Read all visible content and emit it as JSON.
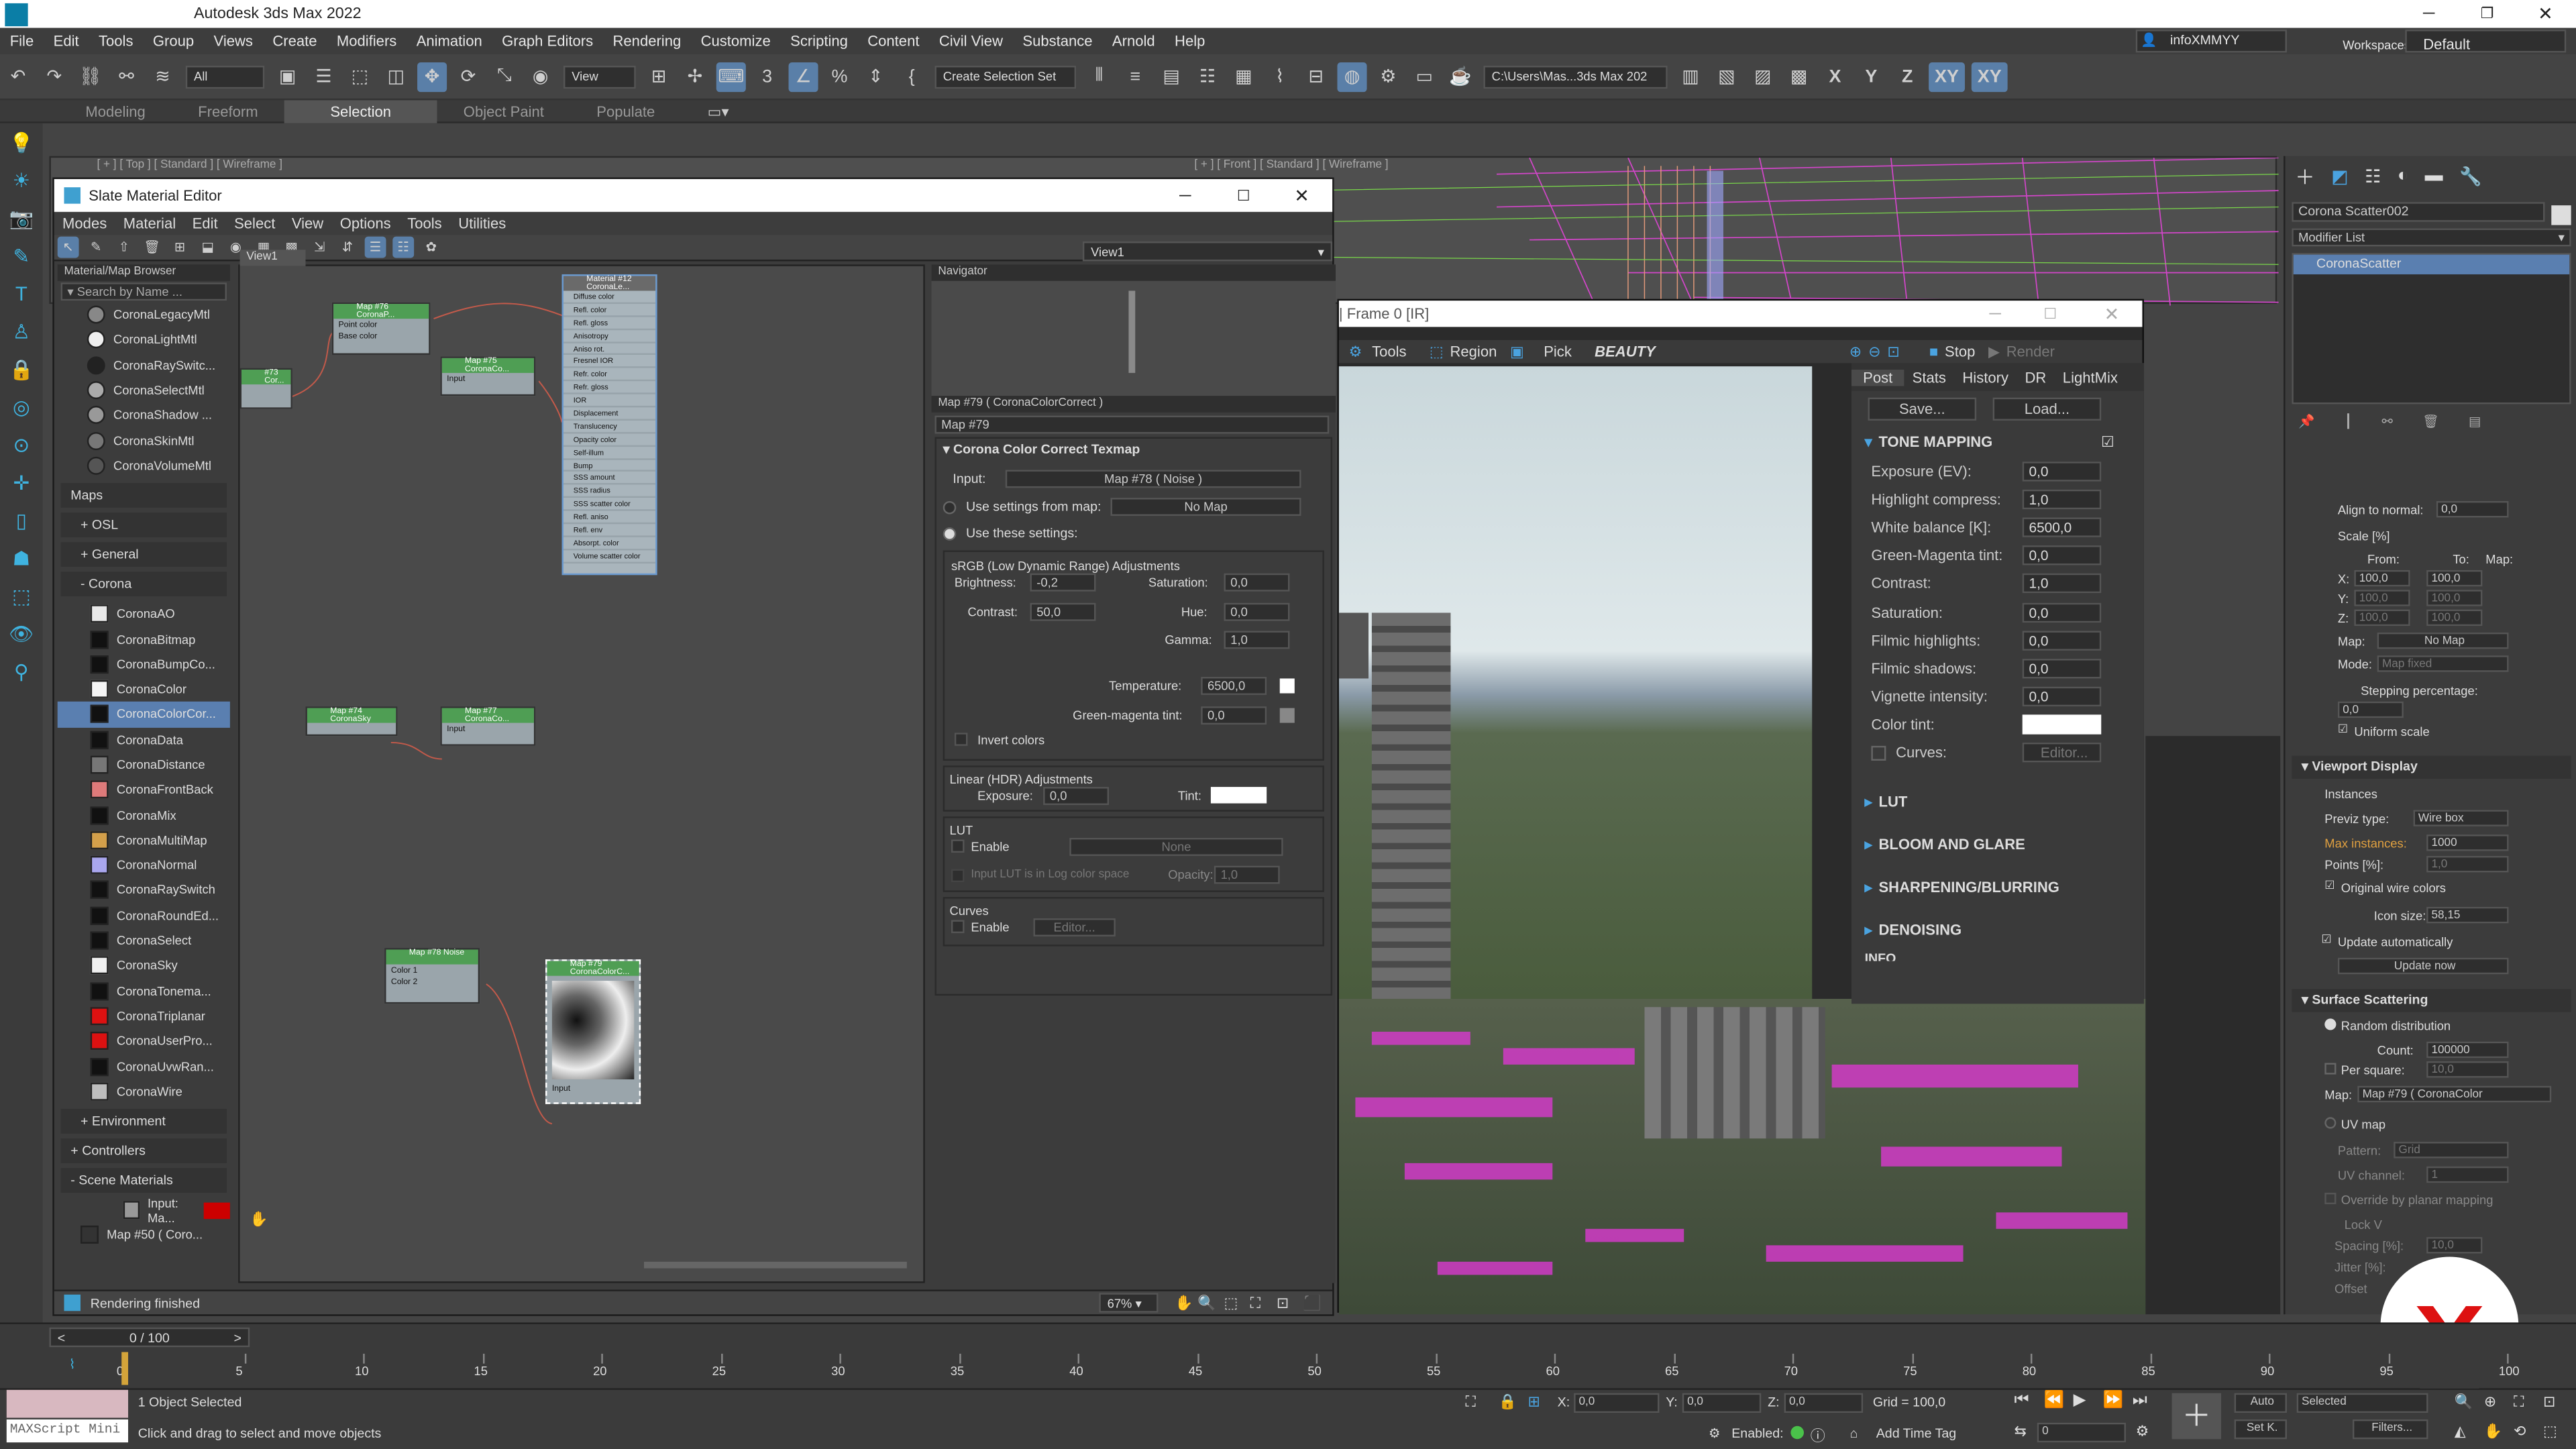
{
  "app": {
    "title": "Autodesk 3ds Max 2022"
  },
  "menu": [
    "File",
    "Edit",
    "Tools",
    "Group",
    "Views",
    "Create",
    "Modifiers",
    "Animation",
    "Graph Editors",
    "Rendering",
    "Customize",
    "Scripting",
    "Content",
    "Civil View",
    "Substance",
    "Arnold",
    "Help"
  ],
  "user": {
    "name": "infoXMMYY",
    "workspaces_label": "Workspaces:",
    "workspace": "Default"
  },
  "toolbar": {
    "filter": "All",
    "view": "View",
    "selection_set": "Create Selection Set",
    "path": "C:\\Users\\Mas...3ds Max 202",
    "axes": [
      "X",
      "Y",
      "Z",
      "XY",
      "XY"
    ]
  },
  "ribbon": {
    "tabs": [
      "Modeling",
      "Freeform",
      "Selection",
      "Object Paint",
      "Populate"
    ],
    "active": "Selection"
  },
  "viewports": {
    "top_label": "[ + ] [ Top ] [ Standard ] [ Wireframe ]",
    "front_label": "[ + ] [ Front ] [ Standard ] [ Wireframe ]"
  },
  "slate": {
    "title": "Slate Material Editor",
    "menu": [
      "Modes",
      "Material",
      "Edit",
      "Select",
      "View",
      "Options",
      "Tools",
      "Utilities"
    ],
    "view_tab": "View1",
    "view_dropdown": "View1",
    "browser_title": "Material/Map Browser",
    "search_placeholder": "Search by Name ...",
    "materials": [
      "CoronaLegacyMtl",
      "CoronaLightMtl",
      "CoronaRaySwitc...",
      "CoronaSelectMtl",
      "CoronaShadow ...",
      "CoronaSkinMtl",
      "CoronaVolumeMtl"
    ],
    "groups": {
      "maps": "Maps",
      "osl": "+ OSL",
      "general": "+ General",
      "corona": "- Corona",
      "environment": "+ Environment",
      "controllers": "+ Controllers",
      "scene": "- Scene Materials"
    },
    "maps": [
      "CoronaAO",
      "CoronaBitmap",
      "CoronaBumpCo...",
      "CoronaColor",
      "CoronaColorCor...",
      "CoronaData",
      "CoronaDistance",
      "CoronaFrontBack",
      "CoronaMix",
      "CoronaMultiMap",
      "CoronaNormal",
      "CoronaRaySwitch",
      "CoronaRoundEd...",
      "CoronaSelect",
      "CoronaSky",
      "CoronaTonema...",
      "CoronaTriplanar",
      "CoronaUserPro...",
      "CoronaUvwRan...",
      "CoronaWire"
    ],
    "map_colors": [
      "#e8e8e8",
      "#111111",
      "#111111",
      "#f4f4f4",
      "#111111",
      "#111111",
      "#777777",
      "#e07a7a",
      "#111111",
      "#d4a04a",
      "#a9a6ee",
      "#111111",
      "#111111",
      "#111111",
      "#f0f0f0",
      "#111111",
      "#dd1111",
      "#dd1111",
      "#111111",
      "#bdbdbd"
    ],
    "scene_items": [
      "Input: Ma...",
      "Map #50  ( Coro..."
    ],
    "status": "Rendering finished",
    "zoom": "67%",
    "navigator": "Navigator",
    "nodes": {
      "n76": {
        "title": "Map #76\nCoronaP...",
        "ports": [
          "Point color",
          "Base color"
        ]
      },
      "n75": {
        "title": "Map #75\nCoronaCo...",
        "ports": [
          "Input"
        ]
      },
      "n73": {
        "title": "#73\nCor..."
      },
      "mat": {
        "title": "Material #12\nCoronaLe...",
        "ports": [
          "Diffuse color",
          "Refl. color",
          "Refl. gloss",
          "Anisotropy",
          "Aniso rot.",
          "Fresnel IOR",
          "Refr. color",
          "Refr. gloss",
          "IOR",
          "Displacement",
          "Translucency",
          "Opacity color",
          "Self-illum",
          "Bump",
          "SSS amount",
          "SSS radius",
          "SSS scatter color",
          "Refl. aniso",
          "Refl. env",
          "Absorpt. color",
          "Volume scatter color"
        ]
      },
      "n74": {
        "title": "Map #74\nCoronaSky"
      },
      "n77": {
        "title": "Map #77\nCoronaCo...",
        "ports": [
          "Input"
        ]
      },
      "n78": {
        "title": "Map #78\nNoise",
        "ports": [
          "Color 1",
          "Color 2"
        ]
      },
      "n79": {
        "title": "Map #79\nCoronaColorC...",
        "ports": [
          "Input"
        ]
      }
    },
    "params": {
      "header": "Map #79  ( CoronaColorCorrect )",
      "name": "Map #79",
      "rollout": "Corona Color Correct Texmap",
      "input_label": "Input:",
      "input_value": "Map #78  ( Noise )",
      "use_settings_label": "Use settings from map:",
      "no_map": "No Map",
      "use_these": "Use these settings:",
      "srgb": "sRGB (Low Dynamic Range) Adjustments",
      "brightness": {
        "label": "Brightness:",
        "value": "-0,2"
      },
      "saturation": {
        "label": "Saturation:",
        "value": "0,0"
      },
      "contrast": {
        "label": "Contrast:",
        "value": "50,0"
      },
      "hue": {
        "label": "Hue:",
        "value": "0,0"
      },
      "gamma": {
        "label": "Gamma:",
        "value": "1,0"
      },
      "temperature": {
        "label": "Temperature:",
        "value": "6500,0"
      },
      "gm_tint": {
        "label": "Green-magenta tint:",
        "value": "0,0"
      },
      "invert": "Invert colors",
      "linear": "Linear (HDR) Adjustments",
      "exposure": {
        "label": "Exposure:",
        "value": "0,0"
      },
      "tint": "Tint:",
      "lut": "LUT",
      "enable": "Enable",
      "none": "None",
      "lut_log": "Input LUT is in Log color space",
      "opacity": {
        "label": "Opacity:",
        "value": "1,0"
      },
      "curves": "Curves",
      "editor": "Editor..."
    }
  },
  "vfb": {
    "title": "| Frame 0 [IR]",
    "tools": "Tools",
    "region": "Region",
    "pick": "Pick",
    "channel": "BEAUTY",
    "stop": "Stop",
    "render": "Render",
    "tabs": [
      "Post",
      "Stats",
      "History",
      "DR",
      "LightMix"
    ],
    "save": "Save...",
    "load": "Load...",
    "tone_mapping": "TONE MAPPING",
    "rows": [
      {
        "label": "Exposure (EV):",
        "value": "0,0"
      },
      {
        "label": "Highlight compress:",
        "value": "1,0"
      },
      {
        "label": "White balance [K]:",
        "value": "6500,0"
      },
      {
        "label": "Green-Magenta tint:",
        "value": "0,0"
      },
      {
        "label": "Contrast:",
        "value": "1,0"
      },
      {
        "label": "Saturation:",
        "value": "0,0"
      },
      {
        "label": "Filmic highlights:",
        "value": "0,0"
      },
      {
        "label": "Filmic shadows:",
        "value": "0,0"
      },
      {
        "label": "Vignette intensity:",
        "value": "0,0"
      }
    ],
    "color_tint": "Color tint:",
    "curves": "Curves:",
    "editor": "Editor...",
    "sections": [
      "LUT",
      "BLOOM AND GLARE",
      "SHARPENING/BLURRING",
      "DENOISING"
    ],
    "info": "INFO"
  },
  "command": {
    "object_name": "Corona Scatter002",
    "modifier_list": "Modifier List",
    "modifier": "CoronaScatter",
    "align_normal": {
      "label": "Align to normal:",
      "value": "0,0"
    },
    "scale": "Scale [%]",
    "from": "From:",
    "to": "To:",
    "map": "Map:",
    "x": {
      "from": "100,0",
      "to": "100,0"
    },
    "y": {
      "from": "100,0",
      "to": "100,0"
    },
    "z": {
      "from": "100,0",
      "to": "100,0"
    },
    "map_label": "Map:",
    "no_map": "No Map",
    "mode_label": "Mode:",
    "mode_value": "Map fixed",
    "stepping": "Stepping percentage:",
    "stepping_value": "0,0",
    "uniform": "Uniform scale",
    "viewport_display": "Viewport Display",
    "instances": "Instances",
    "previz_label": "Previz type:",
    "previz": "Wire box",
    "max_inst_label": "Max instances:",
    "max_inst": "1000",
    "points_label": "Points [%]:",
    "points": "1,0",
    "orig_wire": "Original wire colors",
    "icon_size_label": "Icon size:",
    "icon_size": "58,15",
    "update_auto": "Update automatically",
    "update_now": "Update now",
    "surface": "Surface Scattering",
    "random": "Random distribution",
    "count_label": "Count:",
    "count": "100000",
    "per_square": "Per square:",
    "per_square_val": "10,0",
    "map_value": "Map #79  ( CoronaColor",
    "uv_map": "UV map",
    "pattern_label": "Pattern:",
    "pattern": "Grid",
    "uv_channel_label": "UV channel:",
    "uv_channel": "1",
    "override": "Override by planar mapping",
    "lock_v": "Lock V",
    "spacing": "Spacing [%]:",
    "spacing_val": "10,0",
    "jitter": "Jitter [%]:",
    "offset": "Offset"
  },
  "timeline": {
    "frame": "0 / 100",
    "ticks": [
      "0",
      "5",
      "10",
      "15",
      "20",
      "25",
      "30",
      "35",
      "40",
      "45",
      "50",
      "55",
      "60",
      "65",
      "70",
      "75",
      "80",
      "85",
      "90",
      "95",
      "100"
    ]
  },
  "status": {
    "objects": "1 Object Selected",
    "hint": "Click and drag to select and move objects",
    "maxscript": "MAXScript Mini",
    "x": "0,0",
    "y": "0,0",
    "z": "0,0",
    "grid": "Grid = 100,0",
    "enabled": "Enabled:",
    "add_time_tag": "Add Time Tag",
    "auto": "Auto",
    "selected": "Selected",
    "set_k": "Set K.",
    "filters": "Filters...",
    "frame": "0"
  }
}
